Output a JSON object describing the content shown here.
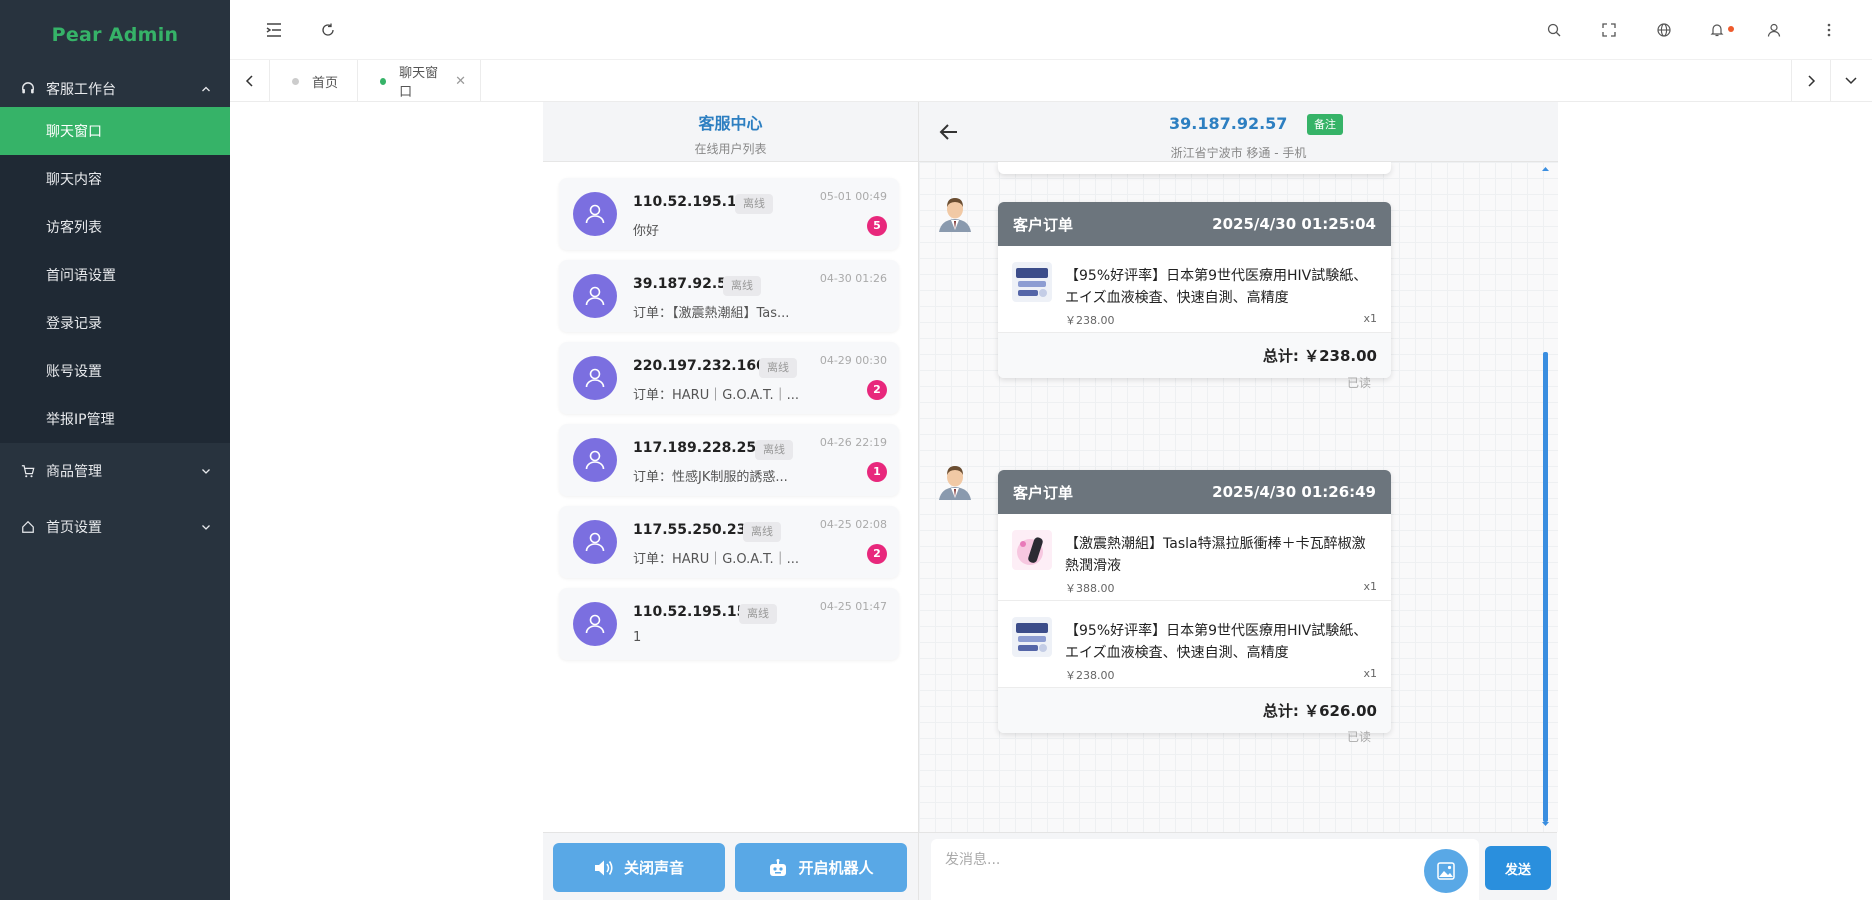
{
  "app": {
    "logo": "Pear Admin",
    "brand_color": "#36b368",
    "sidebar_bg": "#28333e"
  },
  "sidebar": {
    "groups": [
      {
        "label": "客服工作台",
        "icon": "headset-icon",
        "expanded": true,
        "items": [
          {
            "label": "聊天窗口",
            "active": true
          },
          {
            "label": "聊天内容",
            "active": false
          },
          {
            "label": "访客列表",
            "active": false
          },
          {
            "label": "首问语设置",
            "active": false
          },
          {
            "label": "登录记录",
            "active": false
          },
          {
            "label": "账号设置",
            "active": false
          },
          {
            "label": "举报IP管理",
            "active": false
          }
        ]
      },
      {
        "label": "商品管理",
        "icon": "cart-icon",
        "expanded": false
      },
      {
        "label": "首页设置",
        "icon": "home-icon",
        "expanded": false
      }
    ]
  },
  "tabs": [
    {
      "label": "首页",
      "active": false
    },
    {
      "label": "聊天窗口",
      "active": true,
      "closable": true
    }
  ],
  "list_panel": {
    "title": "客服中心",
    "subtitle": "在线用户列表",
    "conversations": [
      {
        "ip": "110.52.195.110",
        "status": "离线",
        "preview": "你好",
        "time": "05-01 00:49",
        "unread": "5"
      },
      {
        "ip": "39.187.92.57",
        "status": "离线",
        "preview": "订单：【激震熱潮組】Tas...",
        "time": "04-30 01:26",
        "unread": null
      },
      {
        "ip": "220.197.232.160",
        "status": "离线",
        "preview": "订单：HARU｜G.O.A.T.｜...",
        "time": "04-29 00:30",
        "unread": "2"
      },
      {
        "ip": "117.189.228.250",
        "status": "离线",
        "preview": "订单：性感JK制服的誘惑...",
        "time": "04-26 22:19",
        "unread": "1"
      },
      {
        "ip": "117.55.250.237",
        "status": "离线",
        "preview": "订单：HARU｜G.O.A.T.｜...",
        "time": "04-25 02:08",
        "unread": "2"
      },
      {
        "ip": "110.52.195.150",
        "status": "离线",
        "preview": "1",
        "time": "04-25 01:47",
        "unread": null
      }
    ]
  },
  "chat": {
    "ip": "39.187.92.57",
    "note_label": "备注",
    "location": "浙江省宁波市 移通 - 手机",
    "orders": [
      {
        "title": "客户订单",
        "datetime": "2025/4/30 01:25:04",
        "items": [
          {
            "name": "【95%好评率】日本第9世代医療用HIV試験紙、エイズ血液検査、快速自測、高精度",
            "price": "￥238.00",
            "qty": "x1",
            "thumb": "test-kit"
          }
        ],
        "total": "总计: ￥238.00",
        "read": "已读"
      },
      {
        "title": "客户订单",
        "datetime": "2025/4/30 01:26:49",
        "items": [
          {
            "name": "【激震熱潮組】Tasla特濕拉脈衝棒＋卡瓦醉椒激熱潤滑液",
            "price": "￥388.00",
            "qty": "x1",
            "thumb": "pink-product"
          },
          {
            "name": "【95%好评率】日本第9世代医療用HIV試験紙、エイズ血液検査、快速自測、高精度",
            "price": "￥238.00",
            "qty": "x1",
            "thumb": "test-kit"
          }
        ],
        "total": "总计: ￥626.00",
        "read": "已读"
      }
    ]
  },
  "bottom": {
    "mute_label": "关闭声音",
    "robot_label": "开启机器人",
    "input_placeholder": "发消息...",
    "send_label": "发送"
  }
}
